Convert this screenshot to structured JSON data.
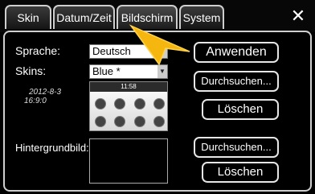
{
  "tabs": [
    {
      "label": "Skin",
      "active": false
    },
    {
      "label": "Datum/Zeit",
      "active": false
    },
    {
      "label": "Bildschirm",
      "active": true
    },
    {
      "label": "System",
      "active": false
    }
  ],
  "close_icon": "✕",
  "form": {
    "language_label": "Sprache:",
    "language_value": "Deutsch",
    "skins_label": "Skins:",
    "skins_value": "Blue *",
    "skin_date": "2012-8-3",
    "skin_ratio": "16:9:0",
    "preview_time": "11:58",
    "background_label": "Hintergrundbild:"
  },
  "buttons": {
    "apply": "Anwenden",
    "browse_skin": "Durchsuchen...",
    "delete_skin": "Löschen",
    "browse_bg": "Durchsuchen...",
    "delete_bg": "Löschen"
  },
  "colors": {
    "pointer": "#f5b70f",
    "border": "#e6e6e6"
  }
}
